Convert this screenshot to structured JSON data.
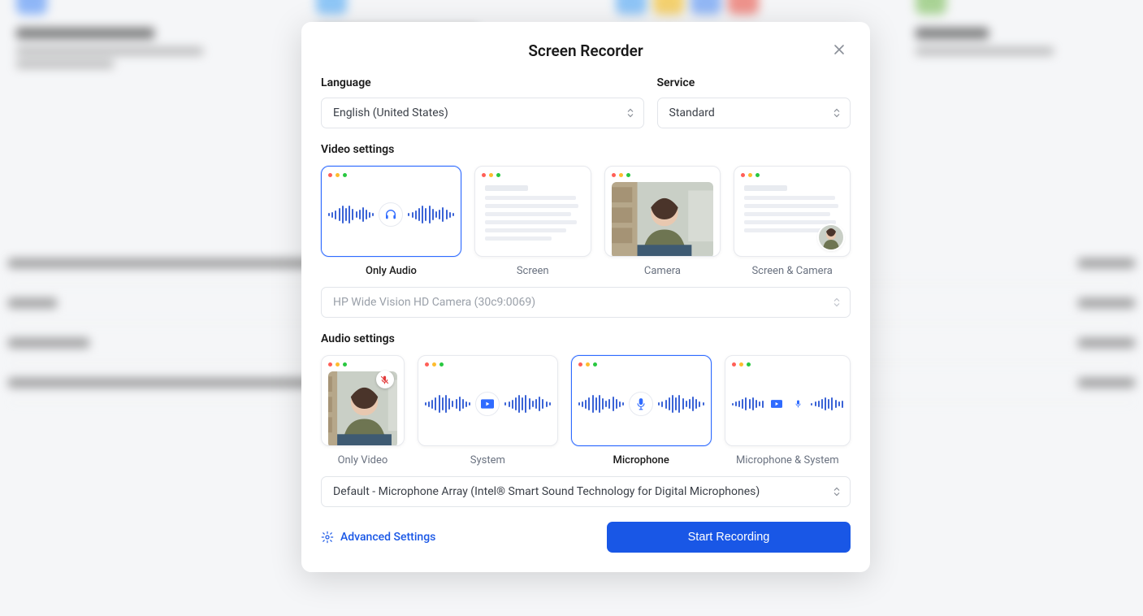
{
  "modal": {
    "title": "Screen Recorder",
    "language_label": "Language",
    "language_value": "English (United States)",
    "service_label": "Service",
    "service_value": "Standard",
    "video_settings_label": "Video settings",
    "video_options": {
      "only_audio": "Only Audio",
      "screen": "Screen",
      "camera": "Camera",
      "screen_camera": "Screen & Camera"
    },
    "camera_select": "HP Wide Vision HD Camera (30c9:0069)",
    "audio_settings_label": "Audio settings",
    "audio_options": {
      "only_video": "Only Video",
      "system": "System",
      "microphone": "Microphone",
      "microphone_system": "Microphone & System"
    },
    "mic_select": "Default - Microphone Array (Intel® Smart Sound Technology for Digital Microphones)",
    "advanced_settings": "Advanced Settings",
    "start_recording": "Start Recording"
  }
}
